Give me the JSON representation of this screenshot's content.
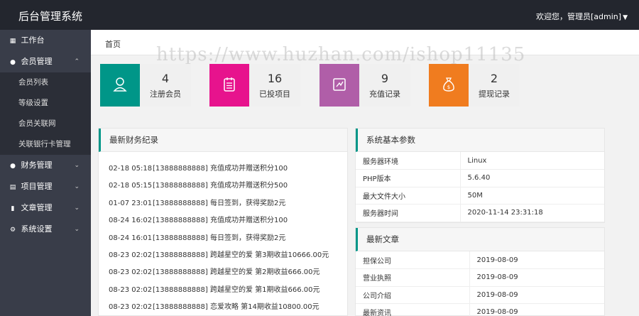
{
  "header": {
    "brand": "后台管理系统",
    "user_greeting": "欢迎您，管理员[admin]"
  },
  "sidebar": {
    "items": [
      {
        "icon": "dashboard-icon",
        "label": "工作台",
        "arrow": ""
      },
      {
        "icon": "member-icon",
        "label": "会员管理",
        "arrow": "up",
        "children": [
          "会员列表",
          "等级设置",
          "会员关联网",
          "关联银行卡管理"
        ]
      },
      {
        "icon": "finance-icon",
        "label": "财务管理",
        "arrow": "down"
      },
      {
        "icon": "project-icon",
        "label": "项目管理",
        "arrow": "down"
      },
      {
        "icon": "article-icon",
        "label": "文章管理",
        "arrow": "down"
      },
      {
        "icon": "settings-icon",
        "label": "系统设置",
        "arrow": "down"
      }
    ]
  },
  "breadcrumb": "首页",
  "watermark": "https://www.huzhan.com/ishop11135",
  "stats": [
    {
      "value": "4",
      "label": "注册会员",
      "color": "#009688",
      "icon": "user-icon"
    },
    {
      "value": "16",
      "label": "已投项目",
      "color": "#e7138d",
      "icon": "clipboard-icon"
    },
    {
      "value": "9",
      "label": "充值记录",
      "color": "#b05ea8",
      "icon": "recharge-icon"
    },
    {
      "value": "2",
      "label": "提现记录",
      "color": "#f07c1f",
      "icon": "moneybag-icon"
    }
  ],
  "finance": {
    "title": "最新财务纪录",
    "rows": [
      {
        "time": "02-18 05:18",
        "text": "[13888888888] 充值成功并赠送积分100"
      },
      {
        "time": "02-18 05:15",
        "text": "[13888888888] 充值成功并赠送积分500"
      },
      {
        "time": "01-07 23:01",
        "text": "[13888888888] 每日签到，获得奖励2元"
      },
      {
        "time": "08-24 16:02",
        "text": "[13888888888] 充值成功并赠送积分100"
      },
      {
        "time": "08-24 16:01",
        "text": "[13888888888] 每日签到，获得奖励2元"
      },
      {
        "time": "08-23 02:02",
        "text": "[13888888888] 跨越星空的爱 第3期收益10666.00元"
      },
      {
        "time": "08-23 02:02",
        "text": "[13888888888] 跨越星空的爱 第2期收益666.00元"
      },
      {
        "time": "08-23 02:02",
        "text": "[13888888888] 跨越星空的爱 第1期收益666.00元"
      },
      {
        "time": "08-23 02:02",
        "text": "[13888888888] 恋爱攻略 第14期收益10800.00元"
      }
    ]
  },
  "system": {
    "title": "系统基本参数",
    "rows": [
      {
        "k": "服务器环境",
        "v": "Linux"
      },
      {
        "k": "PHP版本",
        "v": "5.6.40"
      },
      {
        "k": "最大文件大小",
        "v": "50M"
      },
      {
        "k": "服务器时间",
        "v": "2020-11-14 23:31:18"
      }
    ]
  },
  "articles": {
    "title": "最新文章",
    "rows": [
      {
        "k": "担保公司",
        "v": "2019-08-09"
      },
      {
        "k": "营业执照",
        "v": "2019-08-09"
      },
      {
        "k": "公司介绍",
        "v": "2019-08-09"
      },
      {
        "k": "最新资讯",
        "v": "2019-08-09"
      }
    ]
  }
}
